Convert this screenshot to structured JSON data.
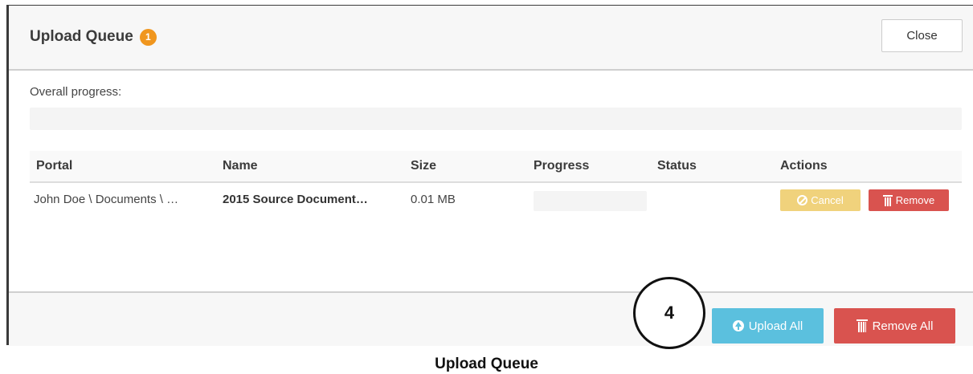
{
  "dialog": {
    "title": "Upload Queue",
    "badge_count": "1",
    "close_label": "Close"
  },
  "overall": {
    "label": "Overall progress:",
    "progress_percent": 0
  },
  "table": {
    "columns": [
      "Portal",
      "Name",
      "Size",
      "Progress",
      "Status",
      "Actions"
    ],
    "rows": [
      {
        "portal": "John Doe \\ Documents \\ …",
        "name": "2015 Source Document…",
        "size": "0.01 MB",
        "progress_percent": 0,
        "status": "",
        "cancel_label": "Cancel",
        "remove_label": "Remove"
      }
    ]
  },
  "footer": {
    "upload_all_label": "Upload All",
    "remove_all_label": "Remove All"
  },
  "callout": {
    "number": "4"
  },
  "caption": "Upload Queue",
  "colors": {
    "badge": "#f0961e",
    "cancel": "#f0d27c",
    "remove": "#d9534f",
    "upload": "#5bc0de"
  },
  "icons": {
    "cancel": "ban-icon",
    "remove": "trash-icon",
    "upload": "arrow-circle-up-icon"
  }
}
